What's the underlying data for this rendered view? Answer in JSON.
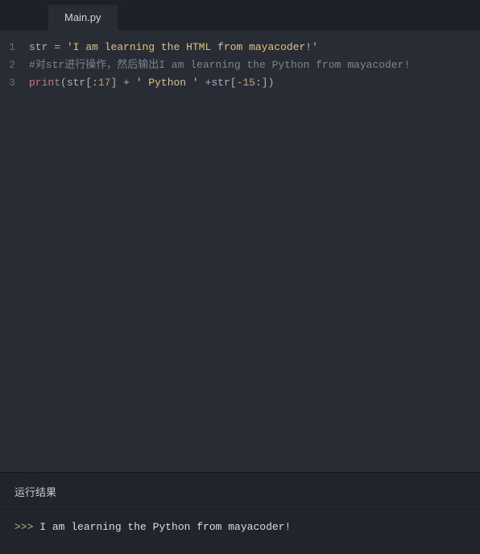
{
  "tab": {
    "label": "Main.py"
  },
  "gutter": {
    "l1": "1",
    "l2": "2",
    "l3": "3"
  },
  "code": {
    "l1": {
      "var": "str",
      "sp1": " ",
      "op": "=",
      "sp2": " ",
      "str": "'I am learning the HTML from mayacoder!'"
    },
    "l2": {
      "comment": "#对str进行操作，然后输出I am learning the Python from mayacoder!"
    },
    "l3": {
      "fn": "print",
      "p1": "(",
      "v1": "str",
      "b1": "[:",
      "n1": "17",
      "b2": "]",
      "sp1": " ",
      "op1": "+",
      "sp2": " ",
      "s1": "' Python '",
      "sp3": " ",
      "op2": "+",
      "v2": "str",
      "b3": "[",
      "n2": "-15",
      "b4": ":]",
      "p2": ")"
    }
  },
  "results": {
    "header": "运行结果",
    "prompt": ">>> ",
    "output": "I am learning the Python from mayacoder!"
  }
}
